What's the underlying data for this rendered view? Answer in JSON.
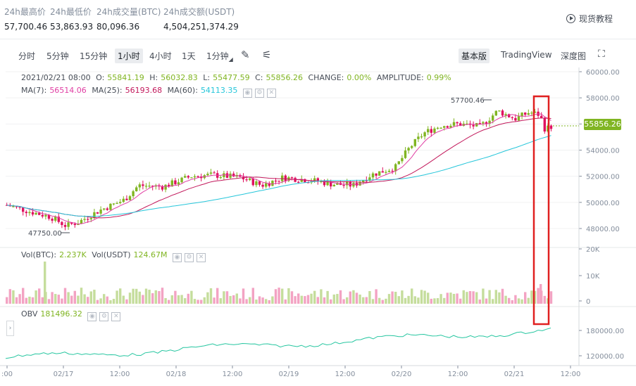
{
  "stats": [
    {
      "label": "24h最高价",
      "value": "57,700.46"
    },
    {
      "label": "24h最低价",
      "value": "53,863.93"
    },
    {
      "label": "24h成交量(BTC)",
      "value": "80,096.36"
    },
    {
      "label": "24h成交额(USDT)",
      "value": "4,504,251,374.29"
    }
  ],
  "tutorial_label": "现货教程",
  "toolbar": {
    "timeframes": [
      "分时",
      "5分钟",
      "15分钟",
      "1小时",
      "4小时",
      "1天",
      "1分钟"
    ],
    "active": "1小时",
    "views": [
      "基本版",
      "TradingView",
      "深度图"
    ],
    "active_view": "基本版"
  },
  "ohlc": {
    "date": "2021/02/21 08:00",
    "o_label": "O:",
    "o": "55841.19",
    "h_label": "H:",
    "h": "56032.83",
    "l_label": "L:",
    "l": "55477.59",
    "c_label": "C:",
    "c": "55856.26",
    "change_label": "CHANGE:",
    "change": "0.00%",
    "amp_label": "AMPLITUDE:",
    "amp": "0.99%"
  },
  "ma": [
    {
      "label": "MA(7):",
      "value": "56514.06",
      "color": "#e03ea3"
    },
    {
      "label": "MA(25):",
      "value": "56193.68",
      "color": "#c2185b"
    },
    {
      "label": "MA(60):",
      "value": "54113.35",
      "color": "#26c6da"
    }
  ],
  "vol": {
    "label1": "Vol(BTC):",
    "value1": "2.237K",
    "label2": "Vol(USDT)",
    "value2": "124.67M"
  },
  "obv": {
    "label": "OBV",
    "value": "181496.32"
  },
  "price_axis": [
    "60000.00",
    "58000.00",
    "56000.00",
    "54000.00",
    "52000.00",
    "50000.00",
    "48000.00"
  ],
  "vol_axis": [
    "20K",
    "10K",
    "0"
  ],
  "obv_axis": [
    "180000.00",
    "120000.00"
  ],
  "time_axis": [
    ":00",
    "02/17",
    "12:00",
    "02/18",
    "12:00",
    "02/19",
    "12:00",
    "02/20",
    "12:00",
    "02/21",
    "12:00"
  ],
  "current_price": "55856.26",
  "high_marker": "57700.46",
  "low_marker": "47750.00",
  "colors": {
    "up": "#80b522",
    "down": "#e0115f",
    "highlight": "#e02020",
    "accent_value": "#80b522"
  }
}
